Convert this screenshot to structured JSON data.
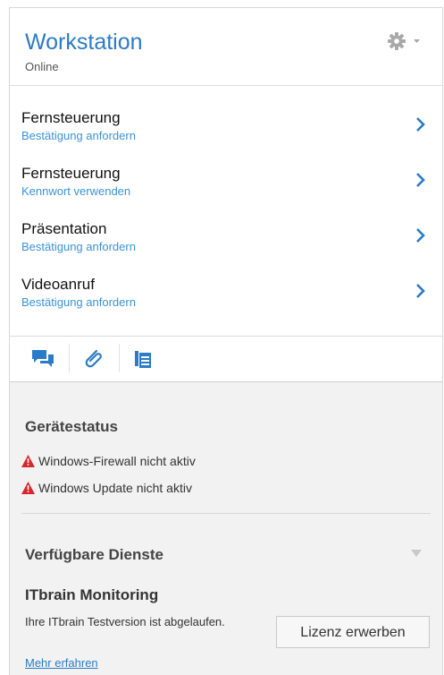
{
  "header": {
    "title": "Workstation",
    "status": "Online",
    "settings_icon": "gear-icon",
    "accent": "#2a7bc8"
  },
  "actions": [
    {
      "label": "Fernsteuerung",
      "sub": "Bestätigung anfordern"
    },
    {
      "label": "Fernsteuerung",
      "sub": "Kennwort verwenden"
    },
    {
      "label": "Präsentation",
      "sub": "Bestätigung anfordern"
    },
    {
      "label": "Videoanruf",
      "sub": "Bestätigung anfordern"
    }
  ],
  "toolbar": {
    "icons": [
      "chat-icon",
      "paperclip-icon",
      "clipboard-list-icon"
    ]
  },
  "device_status": {
    "title": "Gerätestatus",
    "warnings": [
      "Windows-Firewall nicht aktiv",
      "Windows Update nicht aktiv"
    ],
    "warning_color": "#d9262c"
  },
  "services": {
    "title": "Verfügbare Dienste",
    "monitoring": {
      "title": "ITbrain Monitoring",
      "desc": "Ihre ITbrain Testversion ist abgelaufen.",
      "button": "Lizenz erwerben",
      "link": "Mehr erfahren"
    }
  }
}
